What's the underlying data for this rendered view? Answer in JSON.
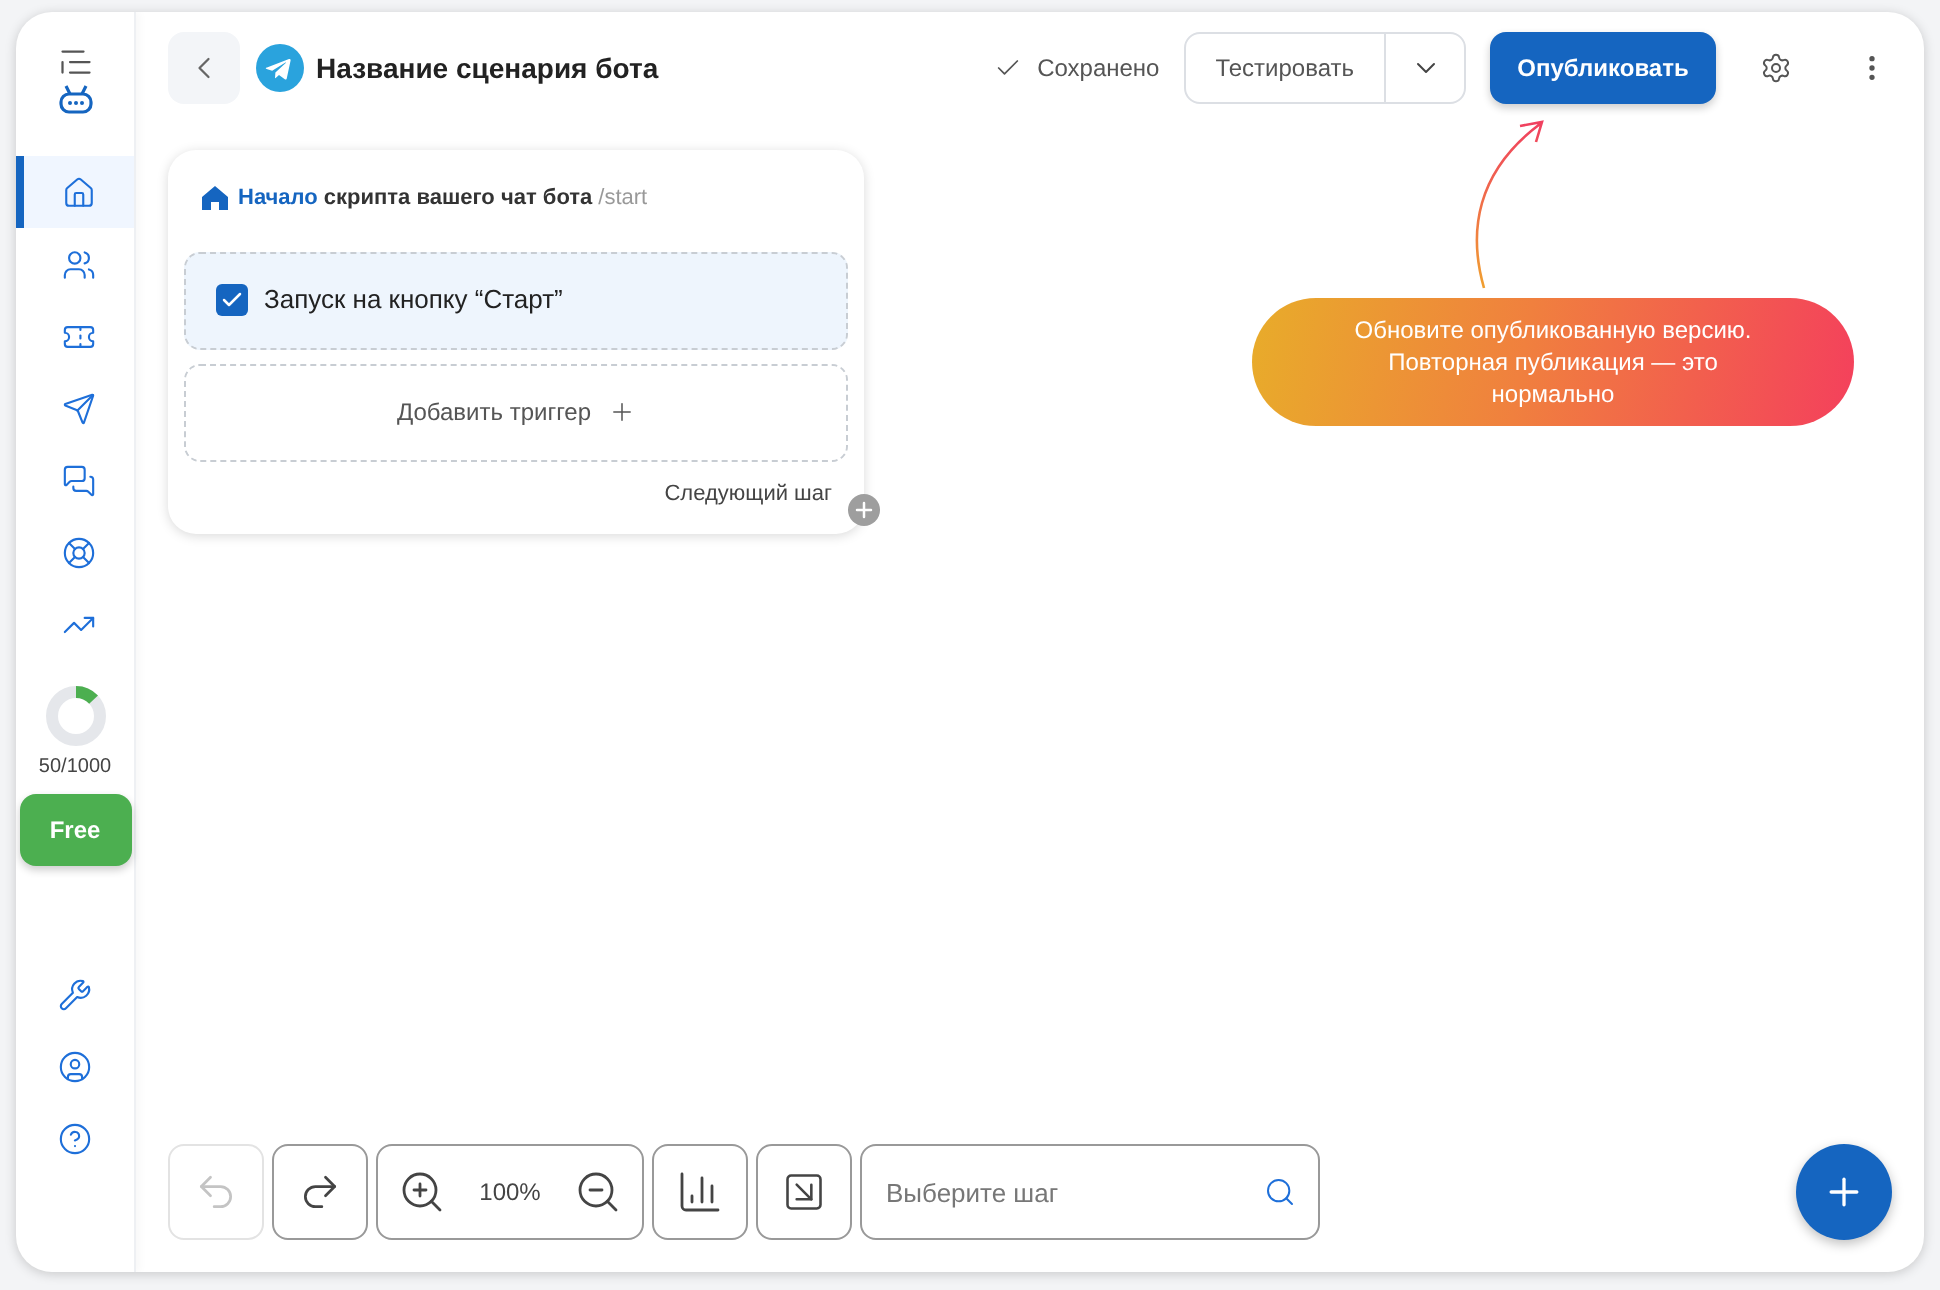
{
  "sidebar": {
    "nav_items": [
      {
        "selected": true
      },
      {
        "selected": false
      },
      {
        "selected": false
      },
      {
        "selected": false
      },
      {
        "selected": false
      },
      {
        "selected": false
      },
      {
        "selected": false
      }
    ],
    "usage": {
      "level": 0.13,
      "label": "50/1000"
    },
    "plan_button": "Free",
    "bottom_items": [
      {
        "selected": false
      },
      {
        "selected": false
      },
      {
        "selected": false
      }
    ]
  },
  "header": {
    "title": "Название сценария бота",
    "saved_status": "Сохранено",
    "test_button": "Тестировать",
    "publish_button": "Опубликовать"
  },
  "start_card": {
    "heading": "**Начало** скрипта вашего чат бота",
    "command": "/start",
    "triggers": [
      {
        "label": "Запуск на кнопку “Старт”",
        "checked": true
      }
    ],
    "add_trigger": "Добавить триггер",
    "next_step": "Следующий шаг"
  },
  "hint": "Обновите опубликованную версию. Повторная публикация — это нормально",
  "toolbar": {
    "undo_disabled": true,
    "redo_disabled": false,
    "zoom": "100%",
    "search_placeholder": "Выберите шаг"
  }
}
